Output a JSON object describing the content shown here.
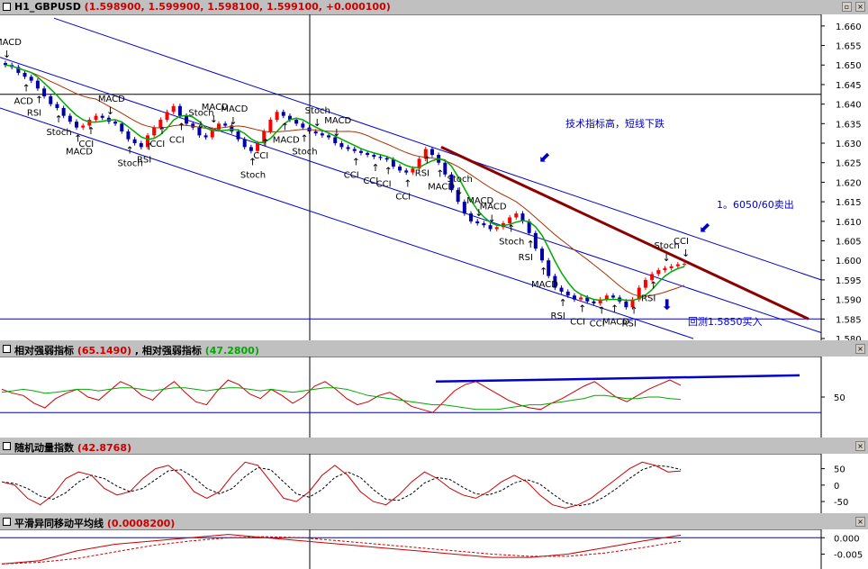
{
  "main_pane": {
    "symbol": "H1_GBPUSD",
    "values": "(1.598900, 1.599900, 1.598100, 1.599100, +0.000100)",
    "title_color": "#cc0000",
    "y_ticks": [
      "1.660",
      "1.655",
      "1.650",
      "1.645",
      "1.640",
      "1.635",
      "1.630",
      "1.625",
      "1.620",
      "1.615",
      "1.610",
      "1.605",
      "1.600",
      "1.595",
      "1.590",
      "1.585",
      "1.580"
    ],
    "annotations": {
      "note_drop": "技术指标高，短线下跌",
      "note_sell": "1。6050/60卖出",
      "note_buy": "回测1.5850买入"
    },
    "signals": [
      {
        "label": "MACD",
        "dir": "down"
      },
      {
        "label": "ACD",
        "dir": "up"
      },
      {
        "label": "RSI",
        "dir": "up"
      },
      {
        "label": "Stoch",
        "dir": "up"
      },
      {
        "label": "MACD",
        "dir": "up"
      },
      {
        "label": "CCI",
        "dir": "up"
      },
      {
        "label": "MACD",
        "dir": "down"
      },
      {
        "label": "Stoch",
        "dir": "up"
      },
      {
        "label": "RSI",
        "dir": "up"
      },
      {
        "label": "CCI",
        "dir": "up"
      },
      {
        "label": "CCI",
        "dir": "up"
      },
      {
        "label": "Stoch",
        "dir": "down"
      },
      {
        "label": "MACD",
        "dir": "down"
      },
      {
        "label": "MACD",
        "dir": "down"
      },
      {
        "label": "Stoch",
        "dir": "up"
      },
      {
        "label": "CCI",
        "dir": "up"
      },
      {
        "label": "MACD",
        "dir": "up"
      },
      {
        "label": "Stoch",
        "dir": "up"
      },
      {
        "label": "Stoch",
        "dir": "down"
      },
      {
        "label": "MACD",
        "dir": "down"
      },
      {
        "label": "CCI",
        "dir": "up"
      },
      {
        "label": "CCI",
        "dir": "up"
      },
      {
        "label": "CCI",
        "dir": "up"
      },
      {
        "label": "CCI",
        "dir": "up"
      },
      {
        "label": "RSI",
        "dir": "up"
      },
      {
        "label": "MACD",
        "dir": "up"
      },
      {
        "label": "Stoch",
        "dir": "down"
      },
      {
        "label": "MACD",
        "dir": "down"
      },
      {
        "label": "MACD",
        "dir": "down"
      },
      {
        "label": "Stoch",
        "dir": "up"
      },
      {
        "label": "RSI",
        "dir": "up"
      },
      {
        "label": "MACD",
        "dir": "up"
      },
      {
        "label": "RSI",
        "dir": "up"
      },
      {
        "label": "CCI",
        "dir": "up"
      },
      {
        "label": "CCI",
        "dir": "up"
      },
      {
        "label": "MACD",
        "dir": "up"
      },
      {
        "label": "RSI",
        "dir": "up"
      },
      {
        "label": "RSI",
        "dir": "up"
      },
      {
        "label": "Stoch",
        "dir": "down"
      },
      {
        "label": "CCI",
        "dir": "down"
      }
    ]
  },
  "rsi_pane": {
    "title_a": "相对强弱指标",
    "value_a": "(65.1490)",
    "title_b": ", 相对强弱指标",
    "value_b": "(47.2800)",
    "y_ticks": [
      "50"
    ]
  },
  "stoch_pane": {
    "title": "随机动量指数",
    "value": "(42.8768)",
    "y_ticks": [
      "50",
      "0",
      "-50"
    ]
  },
  "macd_pane": {
    "title": "平滑异同移动平均线",
    "value": "(0.0008200)",
    "y_ticks": [
      "0.000",
      "-0.005"
    ]
  },
  "colors": {
    "up_candle": "#ff0000",
    "down_candle": "#0000aa",
    "channel": "#0000cc",
    "trendline": "#8b0000",
    "ma_fast": "#00aa00",
    "ma_slow": "#aa3300",
    "rsi_red": "#cc0000",
    "rsi_green": "#00aa00"
  },
  "chart_data": [
    {
      "type": "candlestick",
      "title": "H1_GBPUSD",
      "ylim": [
        1.58,
        1.6625
      ],
      "close": [
        1.65,
        1.6495,
        1.648,
        1.647,
        1.646,
        1.644,
        1.642,
        1.64,
        1.639,
        1.637,
        1.6355,
        1.634,
        1.6345,
        1.636,
        1.637,
        1.6365,
        1.6355,
        1.635,
        1.633,
        1.631,
        1.63,
        1.629,
        1.632,
        1.634,
        1.636,
        1.638,
        1.6395,
        1.637,
        1.635,
        1.634,
        1.632,
        1.6315,
        1.6335,
        1.635,
        1.6345,
        1.633,
        1.631,
        1.629,
        1.628,
        1.63,
        1.633,
        1.636,
        1.638,
        1.637,
        1.636,
        1.635,
        1.634,
        1.633,
        1.6325,
        1.632,
        1.6315,
        1.63,
        1.629,
        1.6285,
        1.628,
        1.6275,
        1.627,
        1.6265,
        1.6262,
        1.6258,
        1.624,
        1.623,
        1.6225,
        1.6235,
        1.626,
        1.6285,
        1.627,
        1.625,
        1.622,
        1.618,
        1.615,
        1.612,
        1.61,
        1.6095,
        1.609,
        1.608,
        1.6085,
        1.6095,
        1.611,
        1.612,
        1.61,
        1.607,
        1.603,
        1.6,
        1.596,
        1.593,
        1.592,
        1.591,
        1.59,
        1.5905,
        1.5895,
        1.589,
        1.59,
        1.591,
        1.5905,
        1.5895,
        1.588,
        1.59,
        1.593,
        1.595,
        1.5965,
        1.5975,
        1.598,
        1.5985,
        1.599,
        1.5991
      ]
    },
    {
      "type": "line",
      "title": "相对强弱指标",
      "series": [
        {
          "name": "相对强弱指标 (65.1490)",
          "values": [
            60,
            55,
            52,
            42,
            36,
            48,
            55,
            60,
            50,
            46,
            58,
            70,
            64,
            52,
            46,
            60,
            70,
            56,
            44,
            40,
            58,
            72,
            66,
            54,
            48,
            60,
            52,
            42,
            50,
            64,
            70,
            60,
            48,
            40,
            44,
            52,
            56,
            48,
            38,
            34,
            30,
            44,
            58,
            66,
            70,
            62,
            54,
            46,
            40,
            36,
            34,
            42,
            48,
            56,
            64,
            70,
            60,
            50,
            44,
            52,
            60,
            66,
            72,
            65
          ]
        },
        {
          "name": "相对强弱指标 (47.2800)",
          "values": [
            56,
            58,
            60,
            58,
            55,
            56,
            58,
            60,
            60,
            58,
            60,
            62,
            62,
            60,
            58,
            60,
            62,
            62,
            60,
            58,
            60,
            62,
            62,
            60,
            58,
            60,
            58,
            56,
            58,
            60,
            62,
            62,
            60,
            56,
            52,
            50,
            48,
            46,
            44,
            42,
            40,
            40,
            38,
            36,
            34,
            34,
            34,
            36,
            38,
            40,
            40,
            42,
            44,
            46,
            48,
            52,
            52,
            50,
            48,
            48,
            50,
            50,
            48,
            47
          ]
        }
      ],
      "ylim": [
        0,
        100
      ]
    },
    {
      "type": "line",
      "title": "随机动量指数",
      "series": [
        {
          "name": "随机动量指数 (42.8768)",
          "values": [
            10,
            0,
            -40,
            -60,
            -30,
            20,
            40,
            30,
            -10,
            -30,
            -20,
            20,
            50,
            60,
            30,
            -20,
            -40,
            -20,
            30,
            70,
            60,
            10,
            -40,
            -50,
            -20,
            30,
            60,
            30,
            -20,
            -50,
            -60,
            -30,
            10,
            40,
            20,
            -10,
            -30,
            -40,
            -20,
            10,
            30,
            10,
            -30,
            -60,
            -70,
            -60,
            -40,
            -10,
            20,
            50,
            70,
            60,
            40,
            43
          ]
        }
      ],
      "ylim": [
        -80,
        90
      ]
    },
    {
      "type": "line",
      "title": "平滑异同移动平均线",
      "series": [
        {
          "name": "平滑异同移动平均线 (0.0008200)",
          "values": [
            -0.008,
            -0.007,
            -0.004,
            -0.002,
            -0.001,
            0.0,
            0.001,
            0.0,
            -0.001,
            -0.002,
            -0.003,
            -0.004,
            -0.005,
            -0.006,
            -0.006,
            -0.005,
            -0.003,
            -0.001,
            0.0008
          ]
        }
      ],
      "ylim": [
        -0.009,
        0.002
      ]
    }
  ]
}
